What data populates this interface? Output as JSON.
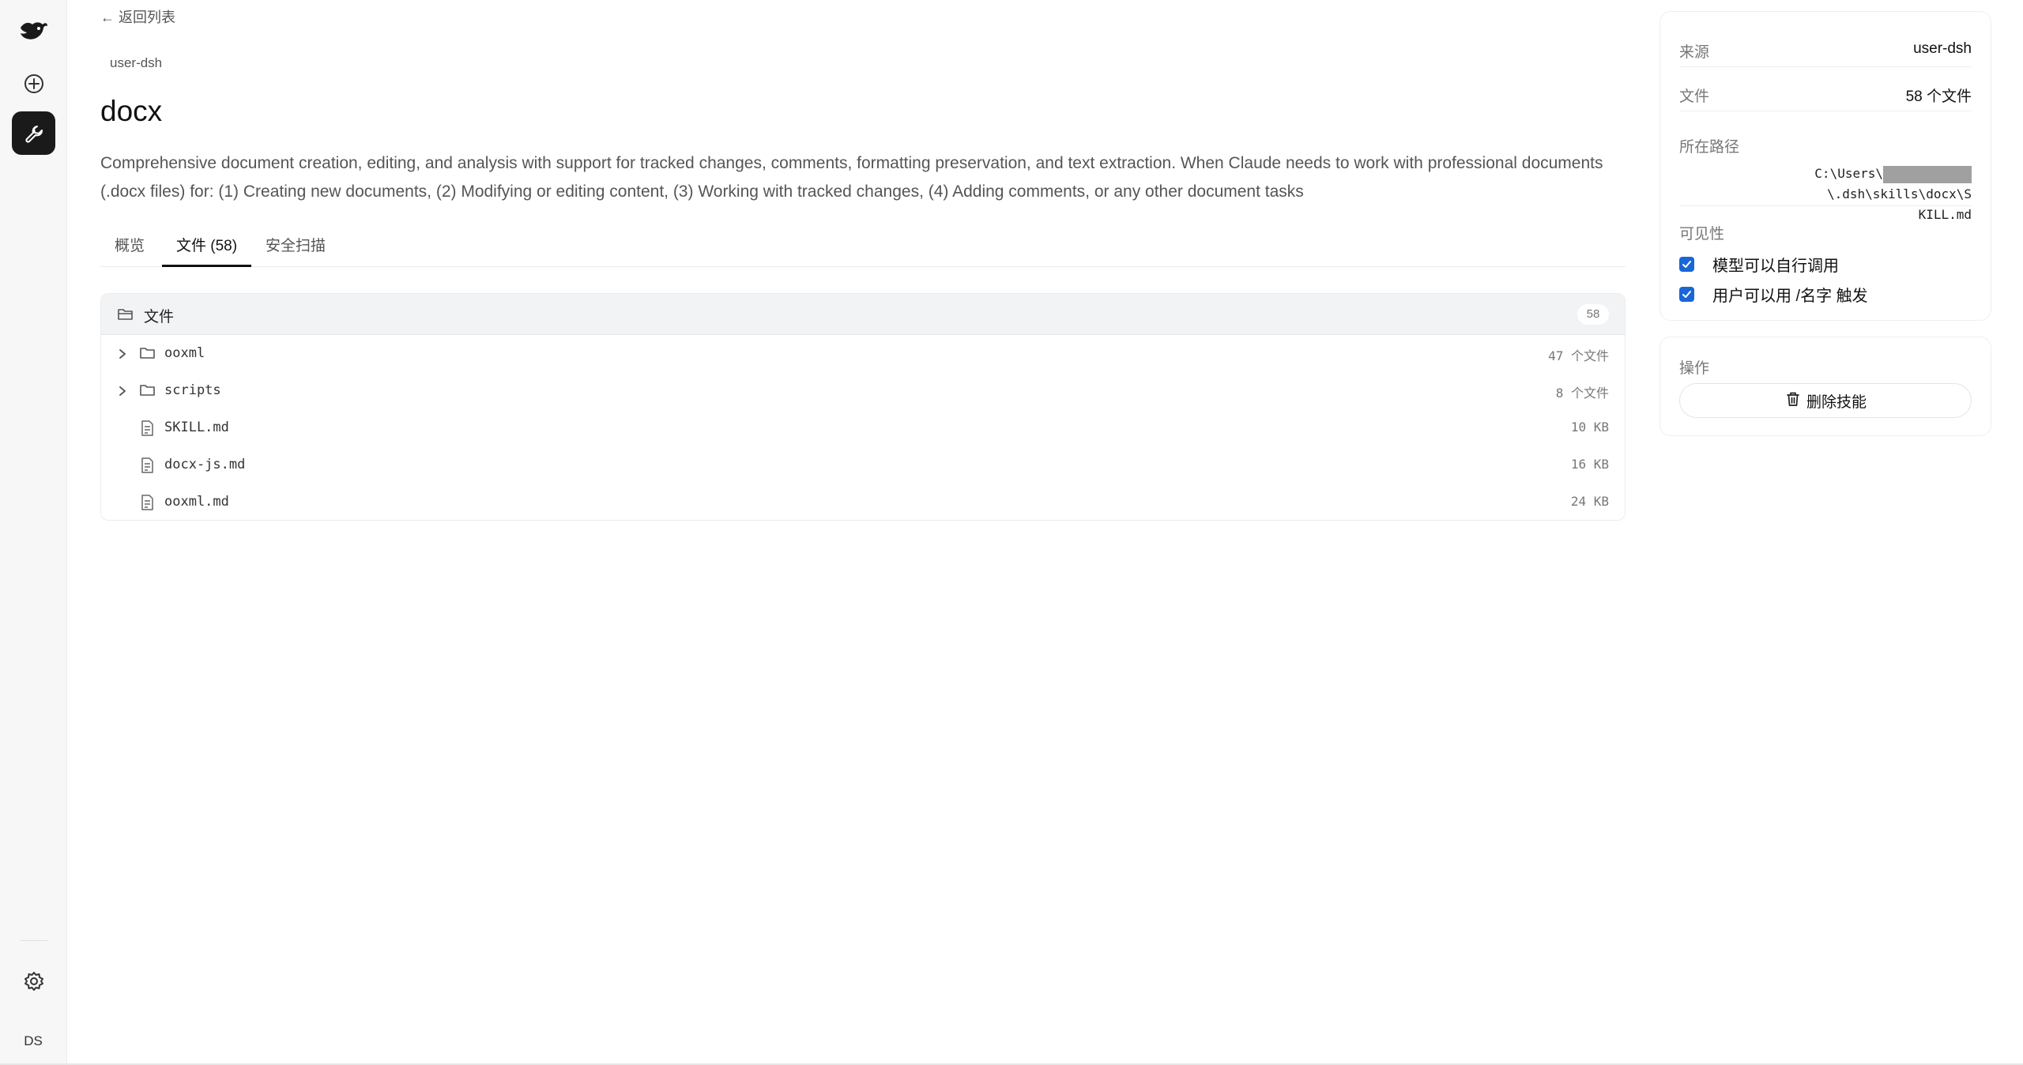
{
  "nav": {
    "back_label": "← 返回列表",
    "avatar_initials": "DS"
  },
  "skill": {
    "source": "user-dsh",
    "title": "docx",
    "description": "Comprehensive document creation, editing, and analysis with support for tracked changes, comments, formatting preservation, and text extraction. When Claude needs to work with professional documents (.docx files) for: (1) Creating new documents, (2) Modifying or editing content, (3) Working with tracked changes, (4) Adding comments, or any other document tasks"
  },
  "tabs": [
    {
      "label": "概览",
      "active": false
    },
    {
      "label": "文件 (58)",
      "active": true
    },
    {
      "label": "安全扫描",
      "active": false
    }
  ],
  "files": {
    "header_label": "文件",
    "count": "58",
    "rows": [
      {
        "type": "folder",
        "name": "ooxml",
        "meta": "47 个文件"
      },
      {
        "type": "folder",
        "name": "scripts",
        "meta": "8 个文件"
      },
      {
        "type": "file",
        "name": "SKILL.md",
        "meta": "10 KB"
      },
      {
        "type": "file",
        "name": "docx-js.md",
        "meta": "16 KB"
      },
      {
        "type": "file",
        "name": "ooxml.md",
        "meta": "24 KB"
      }
    ]
  },
  "sidebar": {
    "source_label": "来源",
    "source_value": "user-dsh",
    "files_label": "文件",
    "files_value": "58 个文件",
    "path_label": "所在路径",
    "path_prefix": "C:\\Users\\",
    "path_suffix_1": "\\.dsh\\skills\\docx\\S",
    "path_suffix_2": "KILL.md",
    "visibility_label": "可见性",
    "visibility_options": [
      {
        "label": "模型可以自行调用",
        "checked": true
      },
      {
        "label": "用户可以用 /名字 触发",
        "checked": true
      }
    ],
    "ops_label": "操作",
    "delete_label": "删除技能"
  },
  "colors": {
    "accent_dark": "#1a1a1a",
    "checkbox": "#1a66d6"
  }
}
